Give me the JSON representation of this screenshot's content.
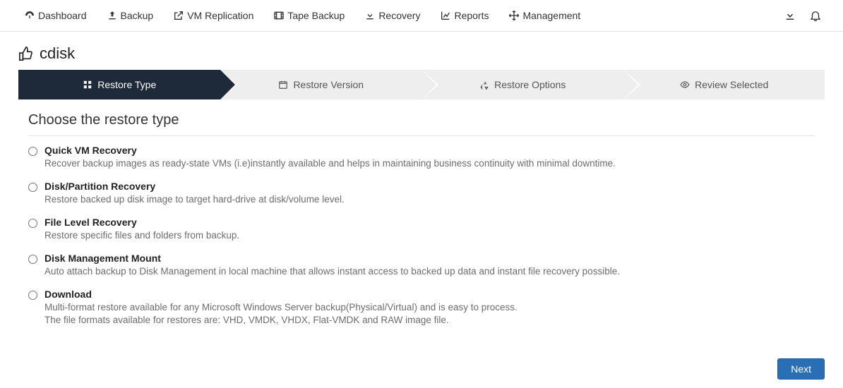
{
  "nav": {
    "items": [
      {
        "label": "Dashboard"
      },
      {
        "label": "Backup"
      },
      {
        "label": "VM Replication"
      },
      {
        "label": "Tape Backup"
      },
      {
        "label": "Recovery"
      },
      {
        "label": "Reports"
      },
      {
        "label": "Management"
      }
    ]
  },
  "page": {
    "title": "cdisk"
  },
  "wizard": {
    "steps": [
      {
        "label": "Restore Type"
      },
      {
        "label": "Restore Version"
      },
      {
        "label": "Restore Options"
      },
      {
        "label": "Review Selected"
      }
    ]
  },
  "section": {
    "heading": "Choose the restore type"
  },
  "options": [
    {
      "title": "Quick VM Recovery",
      "desc": "Recover backup images as ready-state VMs (i.e)instantly available and helps in maintaining business continuity with minimal downtime."
    },
    {
      "title": "Disk/Partition Recovery",
      "desc": "Restore backed up disk image to target hard-drive at disk/volume level."
    },
    {
      "title": "File Level Recovery",
      "desc": "Restore specific files and folders from backup."
    },
    {
      "title": "Disk Management Mount",
      "desc": "Auto attach backup to Disk Management in local machine that allows instant access to backed up data and instant file recovery possible."
    },
    {
      "title": "Download",
      "desc": "Multi-format restore available for any Microsoft Windows Server backup(Physical/Virtual) and is easy to process.\nThe file formats available for restores are: VHD, VMDK, VHDX, Flat-VMDK and RAW image file."
    }
  ],
  "footer": {
    "next_label": "Next"
  }
}
